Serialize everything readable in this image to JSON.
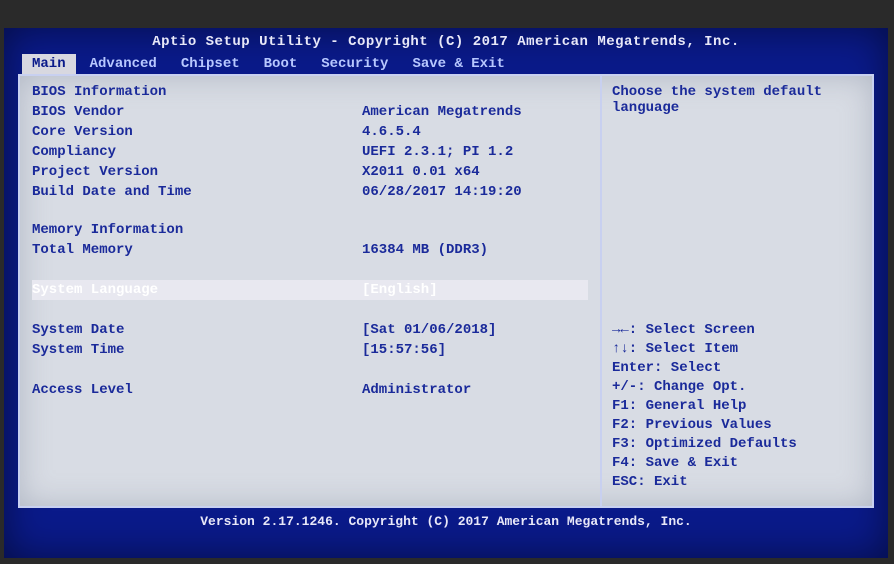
{
  "header": {
    "title": "Aptio Setup Utility - Copyright (C) 2017 American Megatrends, Inc."
  },
  "tabs": {
    "items": [
      {
        "label": "Main"
      },
      {
        "label": "Advanced"
      },
      {
        "label": "Chipset"
      },
      {
        "label": "Boot"
      },
      {
        "label": "Security"
      },
      {
        "label": "Save & Exit"
      }
    ],
    "active_index": 0
  },
  "main": {
    "bios_info_heading": "BIOS Information",
    "bios_vendor_label": "BIOS Vendor",
    "bios_vendor_value": "American Megatrends",
    "core_version_label": "Core Version",
    "core_version_value": "4.6.5.4",
    "compliancy_label": "Compliancy",
    "compliancy_value": "UEFI 2.3.1; PI 1.2",
    "project_version_label": "Project Version",
    "project_version_value": "X2011 0.01 x64",
    "build_date_label": "Build Date and Time",
    "build_date_value": "06/28/2017 14:19:20",
    "memory_info_heading": "Memory Information",
    "total_memory_label": "Total Memory",
    "total_memory_value": "16384 MB (DDR3)",
    "system_language_label": "System Language",
    "system_language_value": "[English]",
    "system_date_label": "System Date",
    "system_date_value": "[Sat 01/06/2018]",
    "system_time_label": "System Time",
    "system_time_value": "[15:57:56]",
    "access_level_label": "Access Level",
    "access_level_value": "Administrator"
  },
  "help": {
    "text_line1": "Choose the system default",
    "text_line2": "language",
    "keys": {
      "select_screen": "→←: Select Screen",
      "select_item": "↑↓: Select Item",
      "enter": "Enter: Select",
      "change": "+/-: Change Opt.",
      "f1": "F1: General Help",
      "f2": "F2: Previous Values",
      "f3": "F3: Optimized Defaults",
      "f4": "F4: Save & Exit",
      "esc": "ESC: Exit"
    }
  },
  "footer": {
    "text": "Version 2.17.1246. Copyright (C) 2017 American Megatrends, Inc."
  }
}
